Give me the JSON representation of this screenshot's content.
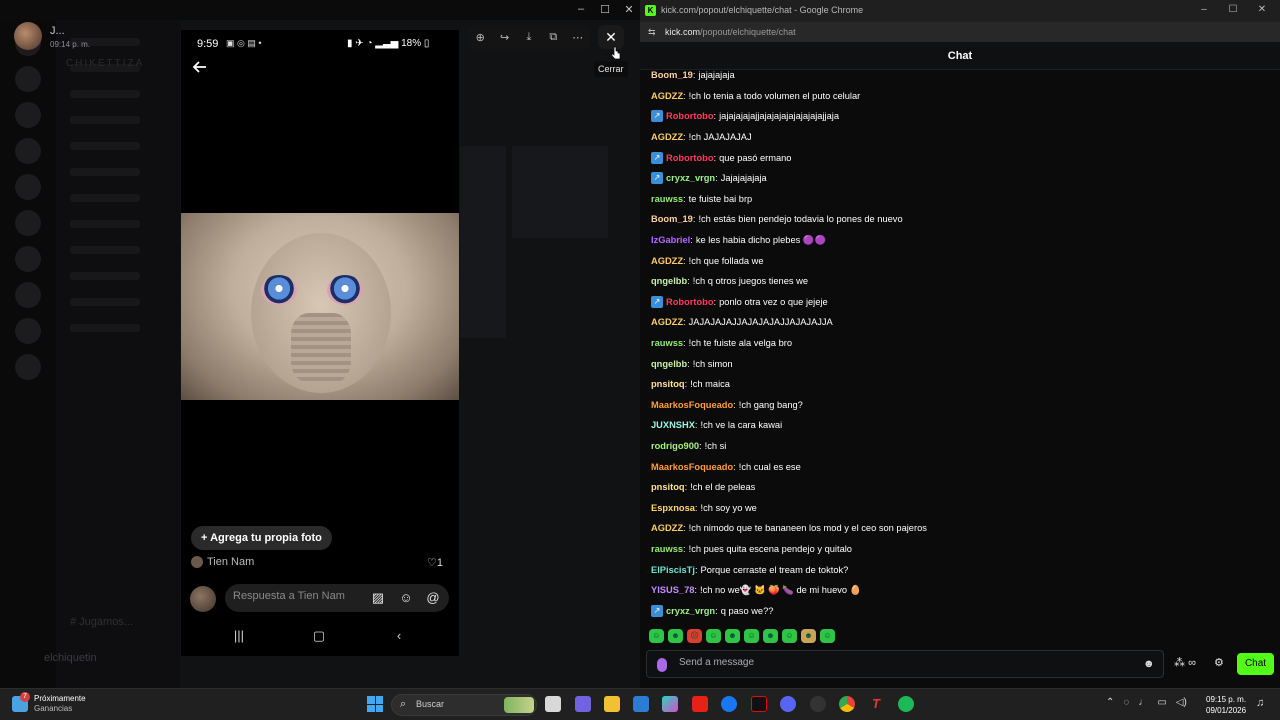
{
  "left_app": {
    "user_name": "J...",
    "user_time": "09:14 p. m.",
    "bottom_user": "elchiquetin",
    "channel_name": "# Jugamos...",
    "server_title": "CHIKETTIZA",
    "window_controls": [
      "–",
      "☐",
      "✕"
    ]
  },
  "phone": {
    "status_time": "9:59",
    "battery": "18%",
    "add_photo_label": "+ Agrega tu propia foto",
    "author": "Tien Nam",
    "likes": "1",
    "reply_placeholder": "Respuesta a Tien Nam"
  },
  "viewer": {
    "close_tooltip": "Cerrar"
  },
  "chrome": {
    "window_title": "kick.com/popout/elchiquette/chat - Google Chrome",
    "url_host": "kick.com",
    "url_path": "/popout/elchiquette/chat",
    "favicon": "K"
  },
  "chat": {
    "header": "Chat",
    "messages": [
      {
        "user": "Boom_19",
        "color": "#ffd1a3",
        "text": "jajajajaja",
        "badge": false
      },
      {
        "user": "AGDZZ",
        "color": "#ffcc66",
        "text": "!ch lo tenia a todo volumen el puto celular",
        "badge": false
      },
      {
        "user": "Robortobo",
        "color": "#ff3b5c",
        "text": "jajajajajajjajajajajajajajajajjaja",
        "badge": true
      },
      {
        "user": "AGDZZ",
        "color": "#ffcc66",
        "text": "!ch JAJAJAJAJ",
        "badge": false
      },
      {
        "user": "Robortobo",
        "color": "#ff3b5c",
        "text": "que pasó ermano",
        "badge": true
      },
      {
        "user": "cryxz_vrgn",
        "color": "#9ff08f",
        "text": "Jajajajajaja",
        "badge": true
      },
      {
        "user": "rauwss",
        "color": "#8ef06d",
        "text": "te fuiste bai brp",
        "badge": false
      },
      {
        "user": "Boom_19",
        "color": "#ffd1a3",
        "text": "!ch estás bien pendejo todavia lo pones de nuevo",
        "badge": false
      },
      {
        "user": "IzGabriel",
        "color": "#b469ff",
        "text": "ke les habia dicho plebes 🟣🟣",
        "badge": false
      },
      {
        "user": "AGDZZ",
        "color": "#ffcc66",
        "text": "!ch que follada we",
        "badge": false
      },
      {
        "user": "qngelbb",
        "color": "#c7f0a6",
        "text": "!ch q otros juegos tienes we",
        "badge": false
      },
      {
        "user": "Robortobo",
        "color": "#ff3b5c",
        "text": "ponlo otra vez o que jejeje",
        "badge": true
      },
      {
        "user": "AGDZZ",
        "color": "#ffcc66",
        "text": "JAJAJAJAJJAJAJAJAJJAJAJAJJA",
        "badge": false
      },
      {
        "user": "rauwss",
        "color": "#8ef06d",
        "text": "!ch te fuiste ala velga bro",
        "badge": false
      },
      {
        "user": "qngelbb",
        "color": "#c7f0a6",
        "text": "!ch simon",
        "badge": false
      },
      {
        "user": "pnsitoq",
        "color": "#ffe28a",
        "text": "!ch maica",
        "badge": false
      },
      {
        "user": "MaarkosFoqueado",
        "color": "#ff9f3a",
        "text": "!ch gang bang?",
        "badge": false
      },
      {
        "user": "JUXNSHX",
        "color": "#9cf5e0",
        "text": "!ch ve la cara kawai",
        "badge": false
      },
      {
        "user": "rodrigo900",
        "color": "#a6f27a",
        "text": "!ch si",
        "badge": false
      },
      {
        "user": "MaarkosFoqueado",
        "color": "#ff9f3a",
        "text": "!ch cual es ese",
        "badge": false
      },
      {
        "user": "pnsitoq",
        "color": "#ffe28a",
        "text": "!ch el de peleas",
        "badge": false
      },
      {
        "user": "Espxnosa",
        "color": "#ffd76a",
        "text": "!ch soy yo we",
        "badge": false
      },
      {
        "user": "AGDZZ",
        "color": "#ffcc66",
        "text": "!ch nimodo que te bananeen los mod y el ceo son pajeros",
        "badge": false
      },
      {
        "user": "rauwss",
        "color": "#8ef06d",
        "text": "!ch pues quita escena pendejo y quitalo",
        "badge": false
      },
      {
        "user": "ElPiscisTj",
        "color": "#6fe3d0",
        "text": "Porque cerraste el tream de toktok?",
        "badge": false
      },
      {
        "user": "YISUS_78",
        "color": "#c58cff",
        "text": "!ch no we👻 🐱 🍑 🍆 de mi huevo 🥚",
        "badge": false
      },
      {
        "user": "cryxz_vrgn",
        "color": "#9ff08f",
        "text": "q paso we??",
        "badge": true
      }
    ],
    "input_placeholder": "Send a message",
    "points_label": "∞",
    "send_label": "Chat"
  },
  "taskbar": {
    "weather_title": "Próximamente",
    "weather_sub": "Ganancias",
    "weather_badge": "7",
    "search_placeholder": "Buscar",
    "clock_time": "09:15 p. m.",
    "clock_date": "09/01/2026"
  }
}
